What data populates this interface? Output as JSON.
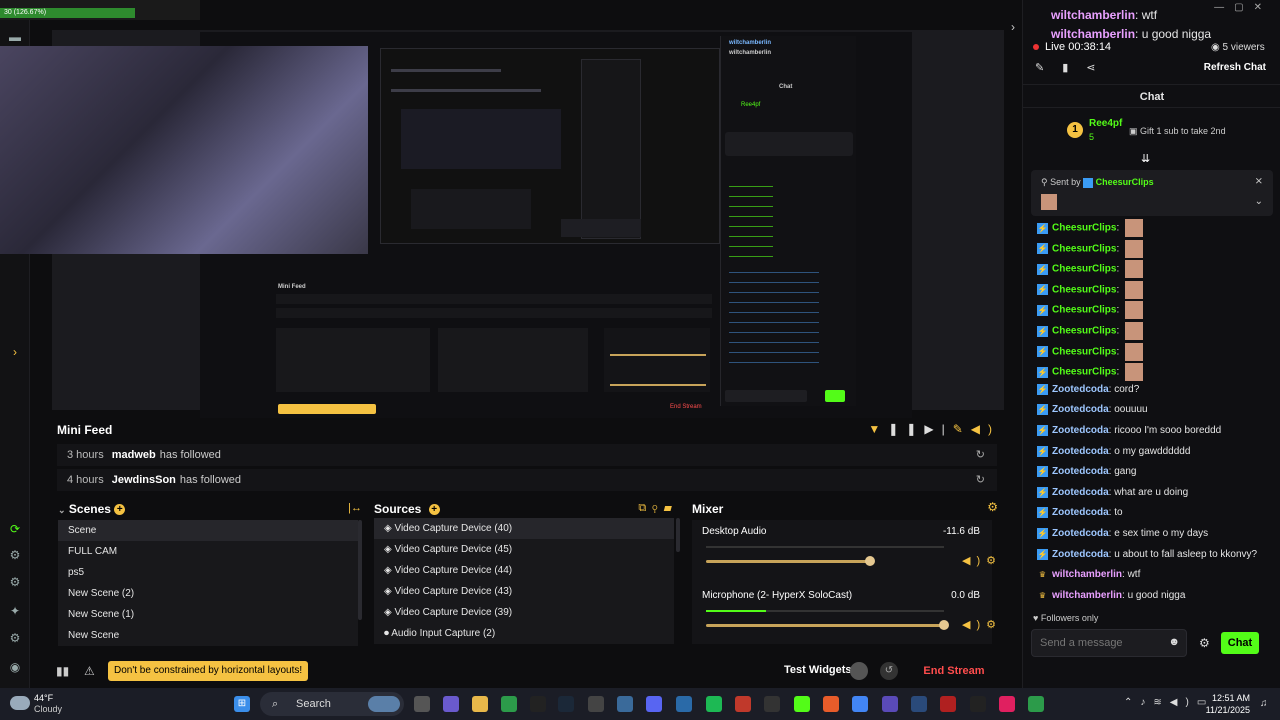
{
  "obs": {
    "title": "Ree4pf",
    "stat": "30 (126.67%)"
  },
  "preview_chat": {
    "user1": "wiltchamberlin",
    "msg1": "wtf",
    "user2": "wiltchamberlin",
    "msg2": "u good nigga"
  },
  "mini_feed": {
    "title": "Mini Feed",
    "rows": [
      {
        "time": "3 hours",
        "user": "madweb",
        "action": "has followed"
      },
      {
        "time": "4 hours",
        "user": "JewdinsSon",
        "action": "has followed"
      }
    ]
  },
  "scenes": {
    "title": "Scenes",
    "items": [
      "Scene",
      "FULL CAM",
      "ps5",
      "New Scene (2)",
      "New Scene (1)",
      "New Scene"
    ]
  },
  "sources": {
    "title": "Sources",
    "items": [
      "Video Capture Device (40)",
      "Video Capture Device (45)",
      "Video Capture Device (44)",
      "Video Capture Device (43)",
      "Video Capture Device (39)",
      "Audio Input Capture (2)"
    ]
  },
  "mixer": {
    "title": "Mixer",
    "channels": [
      {
        "name": "Desktop Audio",
        "db": "-11.6 dB",
        "level": 0.69,
        "meter": 0
      },
      {
        "name": "Microphone (2- HyperX SoloCast)",
        "db": "0.0 dB",
        "level": 1.0,
        "meter": 0.25
      }
    ]
  },
  "bottom": {
    "tip": "Don't be constrained by horizontal layouts!",
    "test_widgets": "Test Widgets",
    "end_stream": "End Stream"
  },
  "chat": {
    "top_lines": [
      {
        "user": "wiltchamberlin",
        "msg": "wtf"
      },
      {
        "user": "wiltchamberlin",
        "msg": "u good nigga"
      }
    ],
    "live": "Live 00:38:14",
    "viewers": "5 viewers",
    "refresh": "Refresh Chat",
    "header": "Chat",
    "gifter": "Ree4pf",
    "gift_rank": "1",
    "gift_count": "5",
    "gift_text": "Gift 1 sub to take 2nd",
    "sent_by_label": "Sent by",
    "sent_by_user": "CheesurClips",
    "messages": [
      {
        "user": "CheesurClips",
        "msg": "",
        "emote": true,
        "color": "green",
        "badge": "bolt"
      },
      {
        "user": "CheesurClips",
        "msg": "",
        "emote": true,
        "color": "green",
        "badge": "bolt"
      },
      {
        "user": "CheesurClips",
        "msg": "",
        "emote": true,
        "color": "green",
        "badge": "bolt"
      },
      {
        "user": "CheesurClips",
        "msg": "",
        "emote": true,
        "color": "green",
        "badge": "bolt"
      },
      {
        "user": "CheesurClips",
        "msg": "",
        "emote": true,
        "color": "green",
        "badge": "bolt"
      },
      {
        "user": "CheesurClips",
        "msg": "",
        "emote": true,
        "color": "green",
        "badge": "bolt"
      },
      {
        "user": "CheesurClips",
        "msg": "",
        "emote": true,
        "color": "green",
        "badge": "bolt"
      },
      {
        "user": "CheesurClips",
        "msg": "",
        "emote": true,
        "color": "green",
        "badge": "bolt"
      },
      {
        "user": "Zootedcoda",
        "msg": "cord?",
        "emote": false,
        "color": "blue",
        "badge": "bolt"
      },
      {
        "user": "Zootedcoda",
        "msg": "oouuuu",
        "emote": false,
        "color": "blue",
        "badge": "bolt"
      },
      {
        "user": "Zootedcoda",
        "msg": "ricooo I'm sooo boreddd",
        "emote": false,
        "color": "blue",
        "badge": "bolt"
      },
      {
        "user": "Zootedcoda",
        "msg": "o my gawdddddd",
        "emote": false,
        "color": "blue",
        "badge": "bolt"
      },
      {
        "user": "Zootedcoda",
        "msg": "gang",
        "emote": false,
        "color": "blue",
        "badge": "bolt"
      },
      {
        "user": "Zootedcoda",
        "msg": "what are u doing",
        "emote": false,
        "color": "blue",
        "badge": "bolt"
      },
      {
        "user": "Zootedcoda",
        "msg": "to",
        "emote": false,
        "color": "blue",
        "badge": "bolt"
      },
      {
        "user": "Zootedcoda",
        "msg": "e sex time o my days",
        "emote": false,
        "color": "blue",
        "badge": "bolt"
      },
      {
        "user": "Zootedcoda",
        "msg": "u about to fall asleep to kkonvy?",
        "emote": false,
        "color": "blue",
        "badge": "bolt"
      },
      {
        "user": "wiltchamberlin",
        "msg": "wtf",
        "emote": false,
        "color": "pink",
        "badge": "crown"
      },
      {
        "user": "wiltchamberlin",
        "msg": "u good nigga",
        "emote": false,
        "color": "pink",
        "badge": "crown"
      }
    ],
    "followers_only": "Followers only",
    "input_placeholder": "Send a message",
    "send_label": "Chat"
  },
  "taskbar": {
    "weather_temp": "44°F",
    "weather_cond": "Cloudy",
    "search": "Search",
    "time": "12:51 AM",
    "date": "11/21/2025"
  },
  "colors": {
    "accent_green": "#53fc18",
    "accent_yellow": "#f5c242",
    "end_stream": "#ff4d4d"
  }
}
